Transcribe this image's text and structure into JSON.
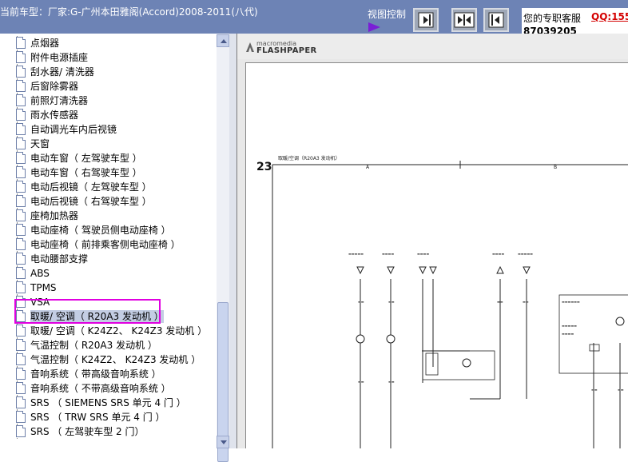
{
  "header": {
    "car_title": "当前车型：厂家:G-广州本田雅阁(Accord)2008-2011(八代)",
    "view_label": "视图控制",
    "service_label": "您的专职客服",
    "qq": "QQ:155",
    "phone": "87039205"
  },
  "tree": {
    "items": [
      {
        "label": "点烟器"
      },
      {
        "label": "附件电源插座"
      },
      {
        "label": "刮水器/ 清洗器"
      },
      {
        "label": "后窗除雾器"
      },
      {
        "label": "前照灯清洗器"
      },
      {
        "label": "雨水传感器"
      },
      {
        "label": "自动调光车内后视镜"
      },
      {
        "label": "天窗"
      },
      {
        "label": "电动车窗（ 左驾驶车型 ）"
      },
      {
        "label": "电动车窗（ 右驾驶车型 ）"
      },
      {
        "label": "电动后视镜（ 左驾驶车型 ）"
      },
      {
        "label": "电动后视镜（ 右驾驶车型 ）"
      },
      {
        "label": "座椅加热器"
      },
      {
        "label": "电动座椅（ 驾驶员侧电动座椅 ）"
      },
      {
        "label": "电动座椅（ 前排乘客侧电动座椅 ）"
      },
      {
        "label": "电动腰部支撑"
      },
      {
        "label": "ABS"
      },
      {
        "label": "TPMS"
      },
      {
        "label": "VSA"
      },
      {
        "label": "取暖/ 空调（ R20A3 发动机 ）"
      },
      {
        "label": "取暖/ 空调（ K24Z2、 K24Z3 发动机 ）"
      },
      {
        "label": "气温控制（ R20A3 发动机 ）"
      },
      {
        "label": "气温控制（ K24Z2、 K24Z3 发动机 ）"
      },
      {
        "label": "音响系统（ 带高级音响系统 ）"
      },
      {
        "label": "音响系统（ 不带高级音响系统 ）"
      },
      {
        "label": "SRS （ SIEMENS SRS 单元 4 门 ）"
      },
      {
        "label": "SRS （ TRW SRS 单元 4 门 ）"
      },
      {
        "label": "SRS （ 左驾驶车型 2 门）"
      }
    ],
    "selected_index": 19
  },
  "viewer": {
    "logo_small": "macromedia",
    "logo_big": "FLASHPAPER",
    "page_number": "23",
    "diagram_title": "取暖/空调（R20A3 发动机）",
    "column_a": "A",
    "column_b": "B"
  },
  "colors": {
    "topbar": "#6d83b5",
    "highlight": "#e000e0",
    "qq": "#d40000",
    "selected_bg": "#c3cde3"
  }
}
